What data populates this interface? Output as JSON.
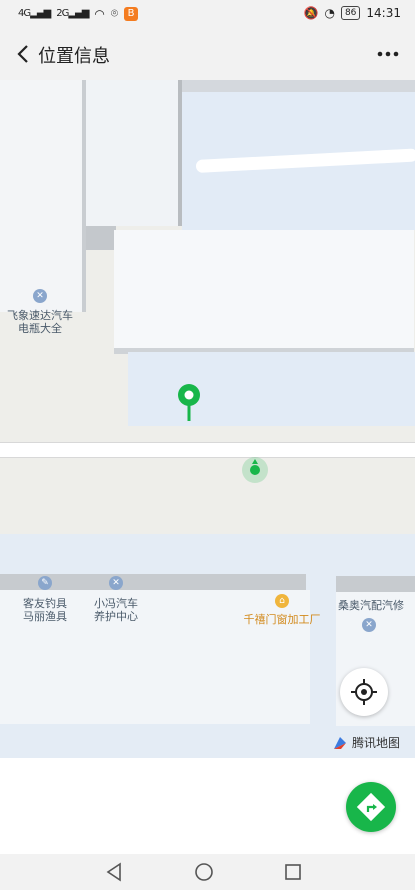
{
  "status": {
    "signal1": "4G",
    "signal2": "2G",
    "app_badge": "B",
    "battery": "86",
    "time": "14:31"
  },
  "header": {
    "title": "位置信息"
  },
  "map": {
    "pois": [
      {
        "name": "飞象速达汽车电瓶大全",
        "line1": "飞象速达汽车",
        "line2": "电瓶大全"
      },
      {
        "name": "客友钓具马丽渔具",
        "line1": "客友钓具",
        "line2": "马丽渔具"
      },
      {
        "name": "小冯汽车养护中心",
        "line1": "小冯汽车",
        "line2": "养护中心"
      },
      {
        "name": "千禧门窗加工厂",
        "line1": "千禧门窗加工厂"
      },
      {
        "name": "桑奥汽配汽修",
        "line1": "桑奥汽配汽修"
      }
    ],
    "attribution": "腾讯地图"
  },
  "colors": {
    "accent": "#18b64a",
    "map_bg": "#eeeeea",
    "building": "#f4f6f8",
    "water_light": "#e3ecf6"
  },
  "icons": {
    "back": "chevron-left-icon",
    "more": "more-dots-icon",
    "pin": "map-pin-icon",
    "locate": "crosshair-icon",
    "navigate": "navigation-diamond-icon"
  }
}
